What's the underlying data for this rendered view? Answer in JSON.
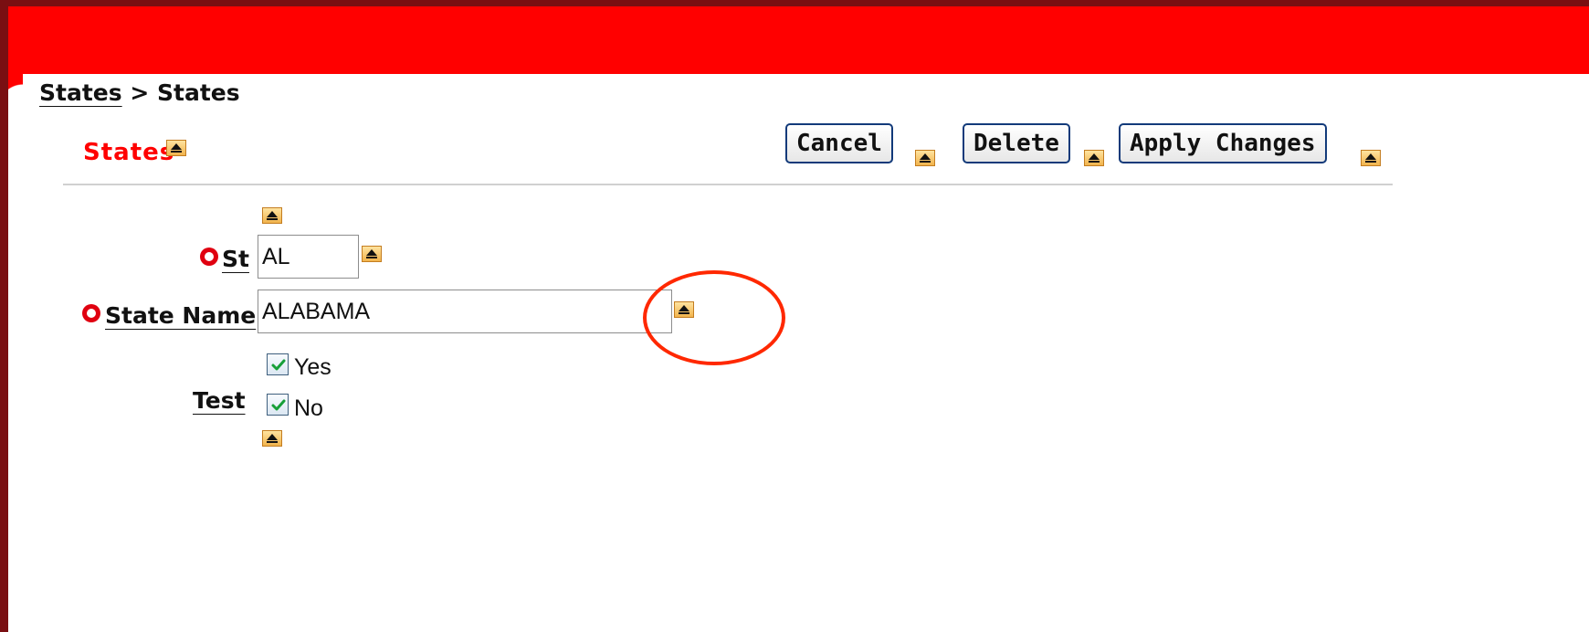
{
  "breadcrumb": {
    "parent": "States",
    "separator": ">",
    "current": "States"
  },
  "region": {
    "title": "States"
  },
  "buttons": {
    "cancel": "Cancel",
    "delete": "Delete",
    "apply": "Apply Changes"
  },
  "form": {
    "st_label": "St",
    "st_value": "AL",
    "state_name_label": "State Name",
    "state_name_value": "ALABAMA",
    "test_label": "Test",
    "test_options": [
      {
        "label": "Yes",
        "checked": true
      },
      {
        "label": "No",
        "checked": true
      }
    ]
  },
  "colors": {
    "header_red": "#ff0000",
    "border_dark_red": "#7a0f12",
    "required_red": "#e00010",
    "annotation_orange": "#ff2800",
    "help_icon_orange": "#f1b34d"
  },
  "icons": {
    "help": "triangle-help-icon",
    "required": "required-circle-icon",
    "check": "check-mark-icon"
  },
  "annotation": {
    "shape": "ellipse",
    "highlighted_item": "state-name-help-icon"
  }
}
